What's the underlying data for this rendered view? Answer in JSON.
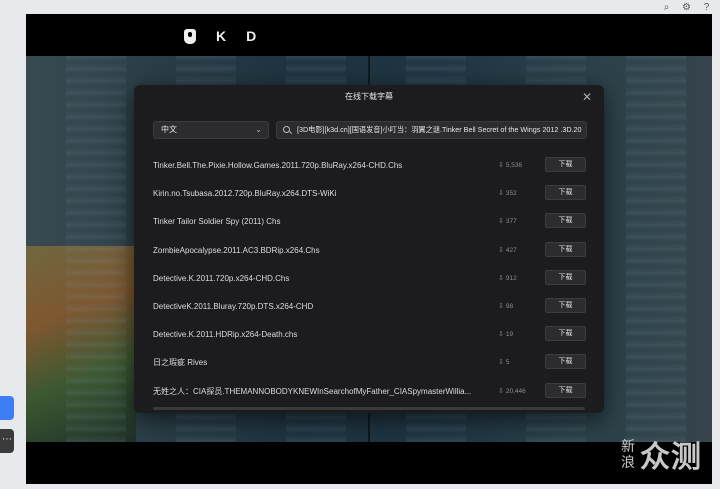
{
  "player": {
    "logo_letters": [
      "K",
      "D"
    ]
  },
  "dialog": {
    "title": "在线下载字幕",
    "close_glyph": "✕",
    "language": {
      "selected": "中文"
    },
    "search": {
      "value": "[3D电影][k3d.cn][国语发音]小叮当：羽翼之谜.Tinker Bell Secret of the Wings 2012 .3D.20"
    },
    "download_label": "下载",
    "results": [
      {
        "name": "Tinker.Bell.The.Pixie.Hollow.Games.2011.720p.BluRay.x264-CHD.Chs",
        "downloads": "5,536"
      },
      {
        "name": "Kirin.no.Tsubasa.2012.720p.BluRay.x264.DTS-WiKi",
        "downloads": "352"
      },
      {
        "name": "Tinker Tailor Soldier Spy (2011) Chs",
        "downloads": "377"
      },
      {
        "name": "ZombieApocalypse.2011.AC3.BDRip.x264.Chs",
        "downloads": "427"
      },
      {
        "name": "Detective.K.2011.720p.x264-CHD.Chs",
        "downloads": "912"
      },
      {
        "name": "DetectiveK.2011.Bluray.720p.DTS.x264-CHD",
        "downloads": "98"
      },
      {
        "name": "Detective.K.2011.HDRip.x264-Death.chs",
        "downloads": "19"
      },
      {
        "name": "日之瑕疵 Rives",
        "downloads": "5"
      },
      {
        "name": "无姓之人：CIA探员.THEMANNOBODYKNEWInSearchofMyFather_CIASpymasterWillia...",
        "downloads": "20,446"
      }
    ]
  },
  "watermark": {
    "small": "新浪",
    "big": "众测"
  },
  "side": {
    "more_glyph": "⋯"
  },
  "icons": [
    "search-icon",
    "settings-icon",
    "help-icon",
    "download-count-icon",
    "close-icon",
    "chevron-down-icon"
  ]
}
